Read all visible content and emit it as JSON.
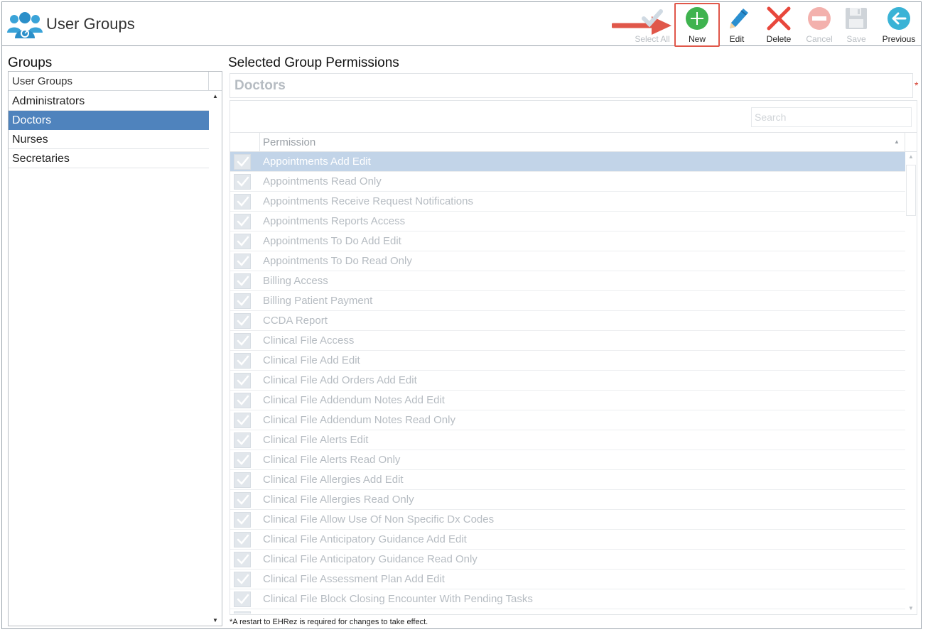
{
  "app": {
    "title": "User Groups"
  },
  "toolbar": {
    "select_all": "Select All",
    "new": "New",
    "edit": "Edit",
    "delete": "Delete",
    "cancel": "Cancel",
    "save": "Save",
    "previous": "Previous"
  },
  "colors": {
    "accent": "#4f83bd",
    "new_green": "#3fb34f",
    "delete_red": "#e8473c",
    "highlight": "#e0574a"
  },
  "groups": {
    "heading": "Groups",
    "column_header": "User Groups",
    "items": [
      {
        "label": "Administrators",
        "selected": false
      },
      {
        "label": "Doctors",
        "selected": true
      },
      {
        "label": "Nurses",
        "selected": false
      },
      {
        "label": "Secretaries",
        "selected": false
      }
    ]
  },
  "permissions": {
    "heading": "Selected Group Permissions",
    "group_name": "Doctors",
    "required_mark": "*",
    "search_placeholder": "Search",
    "column_header": "Permission",
    "rows": [
      {
        "label": "Appointments Add Edit",
        "checked": true,
        "selected": true
      },
      {
        "label": "Appointments Read Only",
        "checked": true
      },
      {
        "label": "Appointments Receive Request Notifications",
        "checked": true
      },
      {
        "label": "Appointments Reports Access",
        "checked": true
      },
      {
        "label": "Appointments To Do Add Edit",
        "checked": true
      },
      {
        "label": "Appointments To Do Read Only",
        "checked": true
      },
      {
        "label": "Billing Access",
        "checked": true
      },
      {
        "label": "Billing Patient Payment",
        "checked": true
      },
      {
        "label": "CCDA Report",
        "checked": true
      },
      {
        "label": "Clinical File Access",
        "checked": true
      },
      {
        "label": "Clinical File Add Edit",
        "checked": true
      },
      {
        "label": "Clinical File Add Orders Add Edit",
        "checked": true
      },
      {
        "label": "Clinical File Addendum Notes Add Edit",
        "checked": true
      },
      {
        "label": "Clinical File Addendum Notes Read Only",
        "checked": true
      },
      {
        "label": "Clinical File Alerts Edit",
        "checked": true
      },
      {
        "label": "Clinical File Alerts Read Only",
        "checked": true
      },
      {
        "label": "Clinical File Allergies Add Edit",
        "checked": true
      },
      {
        "label": "Clinical File Allergies Read Only",
        "checked": true
      },
      {
        "label": "Clinical File Allow Use Of Non Specific Dx Codes",
        "checked": true
      },
      {
        "label": "Clinical File Anticipatory Guidance Add Edit",
        "checked": true
      },
      {
        "label": "Clinical File Anticipatory Guidance Read Only",
        "checked": true
      },
      {
        "label": "Clinical File Assessment Plan Add Edit",
        "checked": true
      },
      {
        "label": "Clinical File Block Closing Encounter With Pending Tasks",
        "checked": true
      },
      {
        "label": "",
        "checked": true
      }
    ]
  },
  "footer": {
    "note": "*A restart to EHRez is required for changes to take effect."
  }
}
